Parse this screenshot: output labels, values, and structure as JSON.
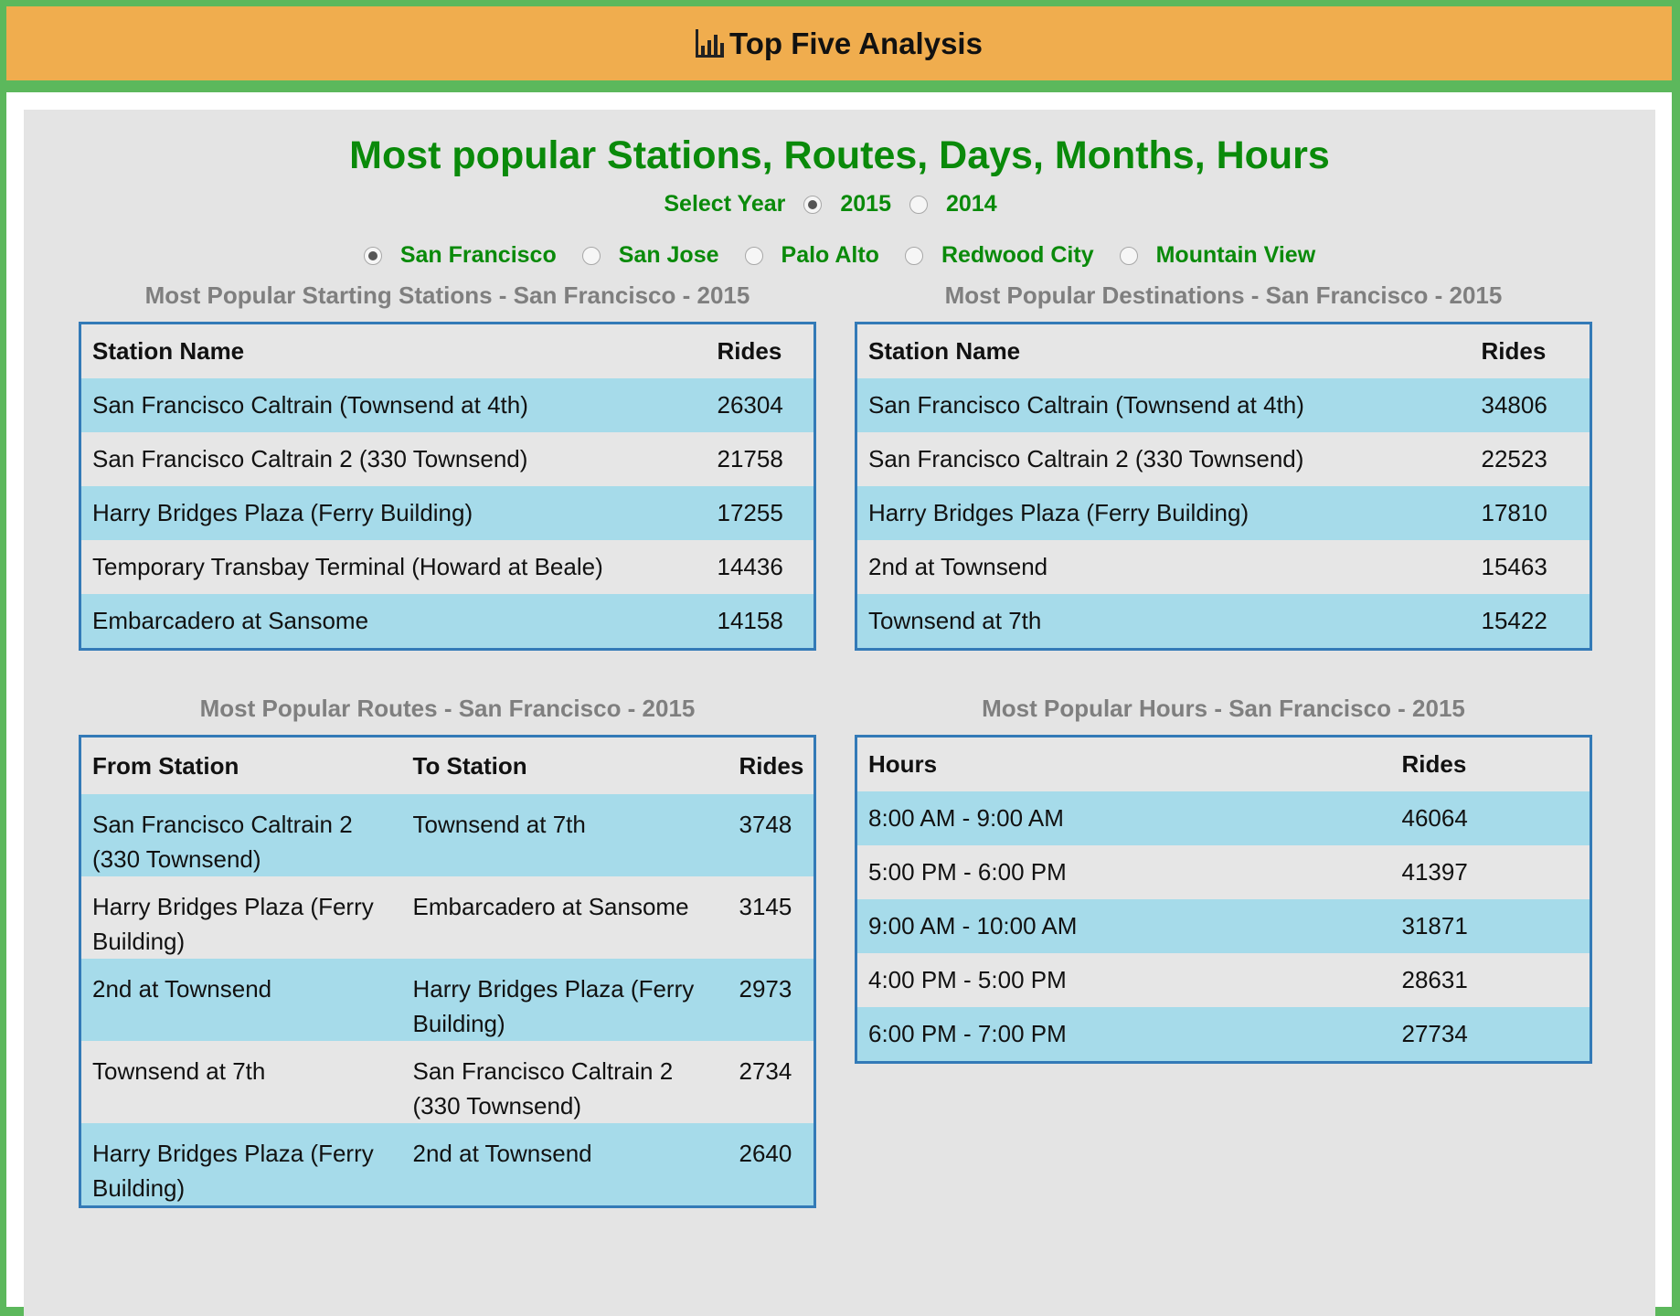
{
  "header": {
    "title": "Top Five Analysis",
    "icon": "bar-chart-icon"
  },
  "main_title": "Most popular Stations, Routes, Days, Months, Hours",
  "year_select": {
    "label": "Select Year",
    "options": [
      "2015",
      "2014"
    ],
    "selected": "2015"
  },
  "cities": {
    "options": [
      "San Francisco",
      "San Jose",
      "Palo Alto",
      "Redwood City",
      "Mountain View"
    ],
    "selected": "San Francisco"
  },
  "starting": {
    "title": "Most Popular Starting Stations - San Francisco - 2015",
    "headers": [
      "Station Name",
      "Rides"
    ],
    "rows": [
      [
        "San Francisco Caltrain (Townsend at 4th)",
        "26304"
      ],
      [
        "San Francisco Caltrain 2 (330 Townsend)",
        "21758"
      ],
      [
        "Harry Bridges Plaza (Ferry Building)",
        "17255"
      ],
      [
        "Temporary Transbay Terminal (Howard at Beale)",
        "14436"
      ],
      [
        "Embarcadero at Sansome",
        "14158"
      ]
    ]
  },
  "destinations": {
    "title": "Most Popular Destinations - San Francisco - 2015",
    "headers": [
      "Station Name",
      "Rides"
    ],
    "rows": [
      [
        "San Francisco Caltrain (Townsend at 4th)",
        "34806"
      ],
      [
        "San Francisco Caltrain 2 (330 Townsend)",
        "22523"
      ],
      [
        "Harry Bridges Plaza (Ferry Building)",
        "17810"
      ],
      [
        "2nd at Townsend",
        "15463"
      ],
      [
        "Townsend at 7th",
        "15422"
      ]
    ]
  },
  "routes": {
    "title": "Most Popular Routes - San Francisco - 2015",
    "headers": [
      "From Station",
      "To Station",
      "Rides"
    ],
    "rows": [
      [
        "San Francisco Caltrain 2 (330 Townsend)",
        "Townsend at 7th",
        "3748"
      ],
      [
        "Harry Bridges Plaza (Ferry Building)",
        "Embarcadero at Sansome",
        "3145"
      ],
      [
        "2nd at Townsend",
        "Harry Bridges Plaza (Ferry Building)",
        "2973"
      ],
      [
        "Townsend at 7th",
        "San Francisco Caltrain 2 (330 Townsend)",
        "2734"
      ],
      [
        "Harry Bridges Plaza (Ferry Building)",
        "2nd at Townsend",
        "2640"
      ]
    ]
  },
  "hours": {
    "title": "Most Popular Hours - San Francisco - 2015",
    "headers": [
      "Hours",
      "Rides"
    ],
    "rows": [
      [
        "8:00 AM - 9:00 AM",
        "46064"
      ],
      [
        "5:00 PM - 6:00 PM",
        "41397"
      ],
      [
        "9:00 AM - 10:00 AM",
        "31871"
      ],
      [
        "4:00 PM - 5:00 PM",
        "28631"
      ],
      [
        "6:00 PM - 7:00 PM",
        "27734"
      ]
    ]
  },
  "colors": {
    "header_bg": "#f0ad4e",
    "frame_green": "#5cb85c",
    "title_green": "#0a8a0a",
    "table_border": "#337ab7",
    "row_blue": "#a6dbea"
  }
}
